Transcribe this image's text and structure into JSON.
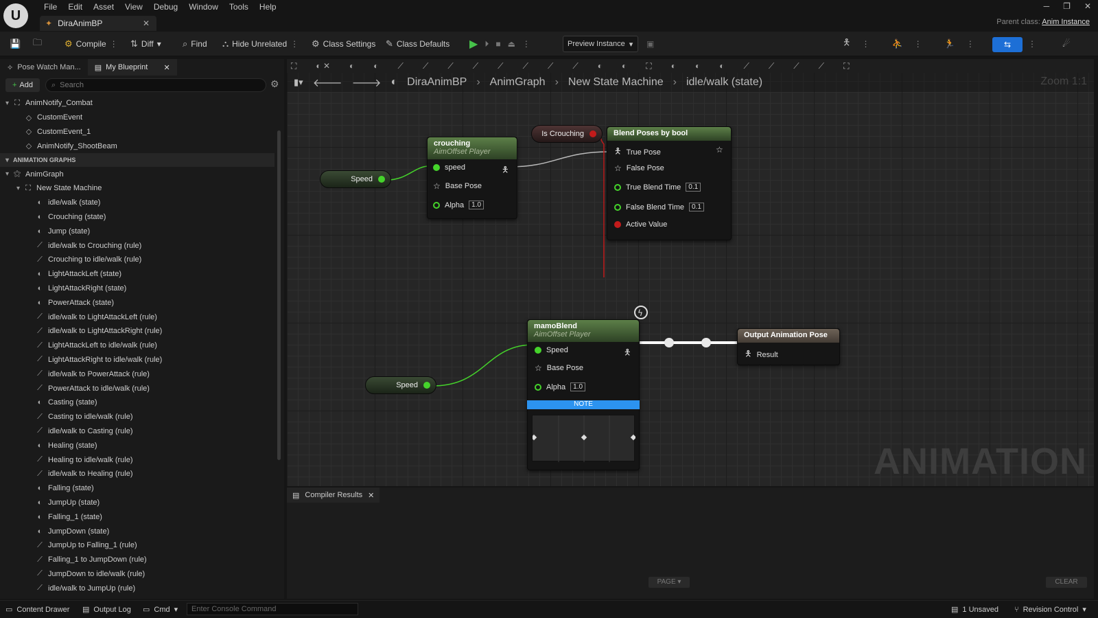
{
  "menu": {
    "items": [
      "File",
      "Edit",
      "Asset",
      "View",
      "Debug",
      "Window",
      "Tools",
      "Help"
    ]
  },
  "document_tab": "DiraAnimBP",
  "parent_class": {
    "label": "Parent class:",
    "value": "Anim Instance"
  },
  "toolbar": {
    "compile": "Compile",
    "diff": "Diff",
    "find": "Find",
    "hide_unrelated": "Hide Unrelated",
    "class_settings": "Class Settings",
    "class_defaults": "Class Defaults",
    "preview_instance": "Preview Instance"
  },
  "left_panel": {
    "tabs": [
      "Pose Watch Man...",
      "My Blueprint"
    ],
    "add_label": "Add",
    "search_placeholder": "Search",
    "tree": [
      {
        "label": "AnimNotify_Combat",
        "kind": "group",
        "indent": 0
      },
      {
        "label": "CustomEvent",
        "kind": "event",
        "indent": 1
      },
      {
        "label": "CustomEvent_1",
        "kind": "event",
        "indent": 1
      },
      {
        "label": "AnimNotify_ShootBeam",
        "kind": "event",
        "indent": 1
      },
      {
        "label": "ANIMATION GRAPHS",
        "kind": "section",
        "indent": 0
      },
      {
        "label": "AnimGraph",
        "kind": "graph",
        "indent": 0
      },
      {
        "label": "New State Machine",
        "kind": "machine",
        "indent": 1
      },
      {
        "label": "idle/walk (state)",
        "kind": "state",
        "indent": 2
      },
      {
        "label": "Crouching (state)",
        "kind": "state",
        "indent": 2
      },
      {
        "label": "Jump (state)",
        "kind": "state",
        "indent": 2
      },
      {
        "label": "idle/walk to Crouching (rule)",
        "kind": "rule",
        "indent": 2
      },
      {
        "label": "Crouching to idle/walk (rule)",
        "kind": "rule",
        "indent": 2
      },
      {
        "label": "LightAttackLeft (state)",
        "kind": "state",
        "indent": 2
      },
      {
        "label": "LightAttackRight (state)",
        "kind": "state",
        "indent": 2
      },
      {
        "label": "PowerAttack (state)",
        "kind": "state",
        "indent": 2
      },
      {
        "label": "idle/walk to LightAttackLeft (rule)",
        "kind": "rule",
        "indent": 2
      },
      {
        "label": "idle/walk to LightAttackRight (rule)",
        "kind": "rule",
        "indent": 2
      },
      {
        "label": "LightAttackLeft to idle/walk (rule)",
        "kind": "rule",
        "indent": 2
      },
      {
        "label": "LightAttackRight to idle/walk (rule)",
        "kind": "rule",
        "indent": 2
      },
      {
        "label": "idle/walk to PowerAttack (rule)",
        "kind": "rule",
        "indent": 2
      },
      {
        "label": "PowerAttack to idle/walk (rule)",
        "kind": "rule",
        "indent": 2
      },
      {
        "label": "Casting (state)",
        "kind": "state",
        "indent": 2
      },
      {
        "label": "Casting to idle/walk (rule)",
        "kind": "rule",
        "indent": 2
      },
      {
        "label": "idle/walk to Casting (rule)",
        "kind": "rule",
        "indent": 2
      },
      {
        "label": "Healing (state)",
        "kind": "state",
        "indent": 2
      },
      {
        "label": "Healing to idle/walk (rule)",
        "kind": "rule",
        "indent": 2
      },
      {
        "label": "idle/walk to Healing (rule)",
        "kind": "rule",
        "indent": 2
      },
      {
        "label": "Falling (state)",
        "kind": "state",
        "indent": 2
      },
      {
        "label": "JumpUp (state)",
        "kind": "state",
        "indent": 2
      },
      {
        "label": "Falling_1 (state)",
        "kind": "state",
        "indent": 2
      },
      {
        "label": "JumpDown (state)",
        "kind": "state",
        "indent": 2
      },
      {
        "label": "JumpUp to Falling_1 (rule)",
        "kind": "rule",
        "indent": 2
      },
      {
        "label": "Falling_1 to JumpDown (rule)",
        "kind": "rule",
        "indent": 2
      },
      {
        "label": "JumpDown to idle/walk (rule)",
        "kind": "rule",
        "indent": 2
      },
      {
        "label": "idle/walk to JumpUp (rule)",
        "kind": "rule",
        "indent": 2
      }
    ]
  },
  "graph": {
    "breadcrumb": [
      "DiraAnimBP",
      "AnimGraph",
      "New State Machine",
      "idle/walk (state)"
    ],
    "zoom": "Zoom 1:1",
    "watermark": "ANIMATION",
    "nodes": {
      "crouching": {
        "title": "crouching",
        "subtitle": "AimOffset Player",
        "pins": {
          "speed": "speed",
          "base_pose": "Base Pose",
          "alpha": "Alpha",
          "alpha_value": "1.0"
        }
      },
      "is_crouching": {
        "label": "Is Crouching"
      },
      "blend": {
        "title": "Blend Poses by bool",
        "pins": {
          "true_pose": "True Pose",
          "false_pose": "False Pose",
          "true_blend": "True Blend Time",
          "true_blend_value": "0.1",
          "false_blend": "False Blend Time",
          "false_blend_value": "0.1",
          "active": "Active Value"
        }
      },
      "speed1": {
        "label": "Speed"
      },
      "speed2": {
        "label": "Speed"
      },
      "mamo": {
        "title": "mamoBlend",
        "subtitle": "AimOffset Player",
        "pins": {
          "speed": "Speed",
          "base_pose": "Base Pose",
          "alpha": "Alpha",
          "alpha_value": "1.0"
        },
        "note": "NOTE"
      },
      "output": {
        "title": "Output Animation Pose",
        "pins": {
          "result": "Result"
        }
      }
    }
  },
  "bottom_panel": {
    "tab": "Compiler Results",
    "page": "PAGE",
    "clear": "CLEAR"
  },
  "statusbar": {
    "content_drawer": "Content Drawer",
    "output_log": "Output Log",
    "cmd": "Cmd",
    "console_placeholder": "Enter Console Command",
    "unsaved": "1 Unsaved",
    "revision_control": "Revision Control"
  },
  "colors": {
    "accent": "#1d6fd6",
    "pose_link": "#ffffff",
    "float_pin": "#45d32b",
    "bool_pin": "#c31b1b",
    "note": "#2c93f0"
  }
}
